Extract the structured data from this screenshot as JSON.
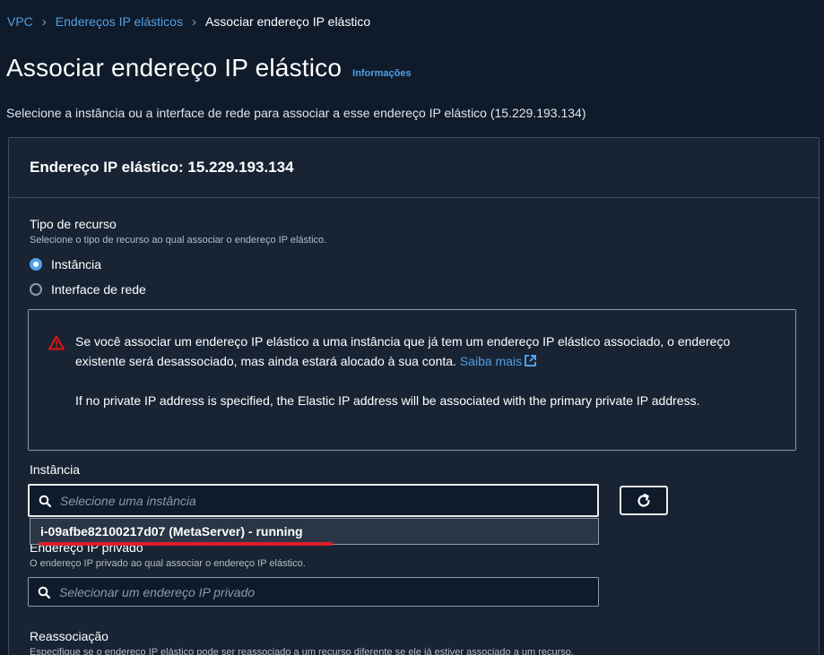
{
  "breadcrumb": {
    "items": [
      "VPC",
      "Endereços IP elásticos"
    ],
    "current": "Associar endereço IP elástico"
  },
  "page": {
    "title": "Associar endereço IP elástico",
    "info_link": "Informações",
    "description": "Selecione a instância ou a interface de rede para associar a esse endereço IP elástico (15.229.193.134)"
  },
  "container": {
    "header": "Endereço IP elástico: 15.229.193.134"
  },
  "resource_type": {
    "label": "Tipo de recurso",
    "description": "Selecione o tipo de recurso ao qual associar o endereço IP elástico.",
    "options": [
      "Instância",
      "Interface de rede"
    ],
    "selected": "Instância"
  },
  "alert": {
    "line1": "Se você associar um endereço IP elástico a uma instância que já tem um endereço IP elástico associado, o endereço existente será desassociado, mas ainda estará alocado à sua conta.",
    "link": "Saiba mais",
    "line2": "If no private IP address is specified, the Elastic IP address will be associated with the primary private IP address."
  },
  "instance": {
    "label": "Instância",
    "placeholder": "Selecione uma instância",
    "dropdown_option": "i-09afbe82100217d07 (MetaServer) - running"
  },
  "private_ip": {
    "label": "Endereço IP privado",
    "description": "O endereço IP privado ao qual associar o endereço IP elástico.",
    "placeholder": "Selecionar um endereço IP privado"
  },
  "reassociation": {
    "label": "Reassociação",
    "description": "Especifique se o endereço IP elástico pode ser reassociado a um recurso diferente se ele já estiver associado a um recurso."
  },
  "colors": {
    "background": "#0f1b2a",
    "panel": "#182433",
    "link": "#539fe5",
    "warning": "#d91515",
    "highlight_mark": "#e01d2b"
  }
}
